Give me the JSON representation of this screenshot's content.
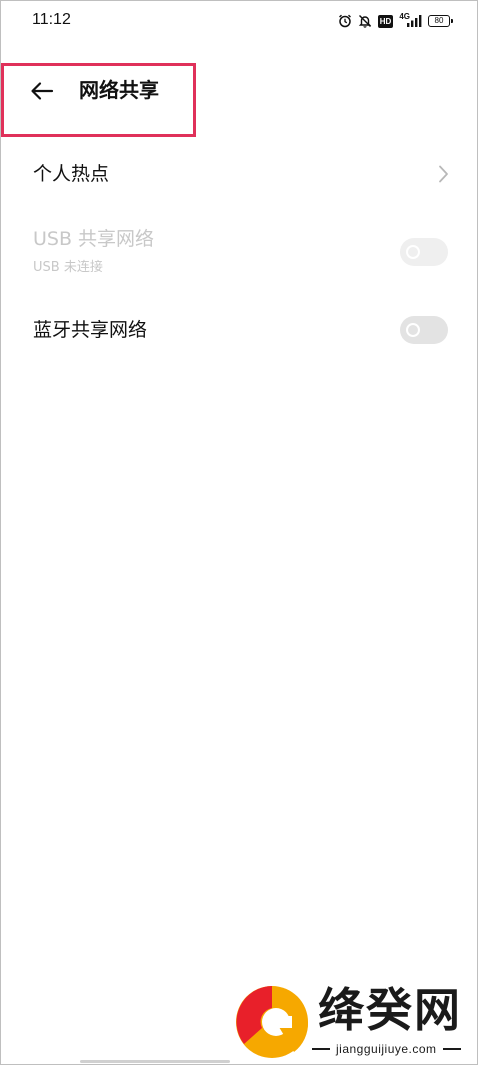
{
  "status_bar": {
    "time": "11:12",
    "network_label": "4G",
    "hd_label": "HD",
    "battery_level": "80",
    "icons": [
      "alarm-icon",
      "bell-off-icon",
      "hd-icon",
      "signal-icon",
      "battery-icon"
    ]
  },
  "header": {
    "title": "网络共享",
    "back_icon": "arrow-left-icon"
  },
  "colors": {
    "highlight": "#e0315a",
    "disabled_text": "#c8c8c8",
    "toggle_off": "#e3e3e3"
  },
  "items": [
    {
      "title": "个人热点",
      "control": "chevron"
    },
    {
      "title": "USB 共享网络",
      "subtitle": "USB 未连接",
      "control": "toggle",
      "enabled": false,
      "on": false
    },
    {
      "title": "蓝牙共享网络",
      "control": "toggle",
      "enabled": true,
      "on": false
    }
  ],
  "watermark": {
    "brand": "绛癸网",
    "url": "jiangguijiuye.com"
  }
}
